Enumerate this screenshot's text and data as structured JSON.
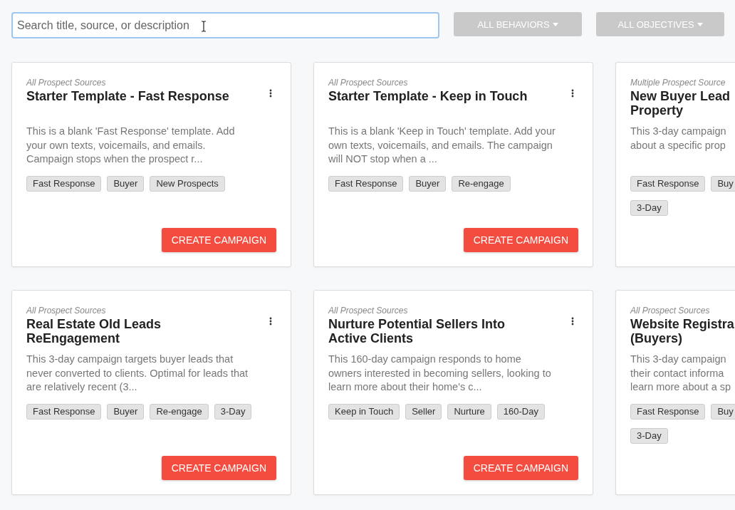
{
  "search": {
    "placeholder": "Search title, source, or description"
  },
  "filters": [
    {
      "label": "ALL BEHAVIORS"
    },
    {
      "label": "ALL OBJECTIVES"
    }
  ],
  "cards": [
    {
      "kind": "full",
      "source": "All Prospect Sources",
      "title_lines": [
        "Starter Template - Fast Response"
      ],
      "description_lines": [
        "This is a blank 'Fast Response' template. Add",
        "your own texts, voicemails, and emails.",
        "Campaign stops when the prospect r..."
      ],
      "tag_rows": [
        [
          "Fast Response",
          "Buyer",
          "New Prospects"
        ]
      ],
      "button": "CREATE CAMPAIGN"
    },
    {
      "kind": "full",
      "source": "All Prospect Sources",
      "title_lines": [
        "Starter Template - Keep in Touch"
      ],
      "description_lines": [
        "This is a blank 'Keep in Touch' template. Add your",
        "own texts, voicemails, and emails. The campaign",
        "will NOT stop when a ..."
      ],
      "tag_rows": [
        [
          "Fast Response",
          "Buyer",
          "Re-engage"
        ]
      ],
      "button": "CREATE CAMPAIGN"
    },
    {
      "kind": "cut",
      "source": "Multiple Prospect Source",
      "title_lines": [
        "New Buyer Lead",
        "Property"
      ],
      "description_lines": [
        "This 3-day campaign",
        "about a specific prop"
      ],
      "tag_rows": [
        [
          "Fast Response",
          "Buy"
        ],
        [
          "3-Day"
        ]
      ]
    },
    {
      "kind": "full",
      "source": "All Prospect Sources",
      "title_lines": [
        "Real Estate Old Leads",
        "ReEngagement"
      ],
      "description_lines": [
        "This 3-day campaign targets buyer leads that",
        "never converted to clients. Optimal for leads that",
        "are relatively recent (3..."
      ],
      "tag_rows": [
        [
          "Fast Response",
          "Buyer",
          "Re-engage",
          "3-Day"
        ]
      ],
      "button": "CREATE CAMPAIGN"
    },
    {
      "kind": "full",
      "source": "All Prospect Sources",
      "title_lines": [
        "Nurture Potential Sellers Into",
        "Active Clients"
      ],
      "description_lines": [
        "This 160-day campaign responds to home",
        "owners interested in becoming sellers, looking to",
        "learn more about their home's c..."
      ],
      "tag_rows": [
        [
          "Keep in Touch",
          "Seller",
          "Nurture",
          "160-Day"
        ]
      ],
      "button": "CREATE CAMPAIGN"
    },
    {
      "kind": "cut",
      "source": "All Prospect Sources",
      "title_lines": [
        "Website Registra",
        "(Buyers)"
      ],
      "description_lines": [
        "This 3-day campaign",
        "their contact informa",
        "learn more about a sp"
      ],
      "tag_rows": [
        [
          "Fast Response",
          "Buy"
        ],
        [
          "3-Day"
        ]
      ]
    }
  ]
}
